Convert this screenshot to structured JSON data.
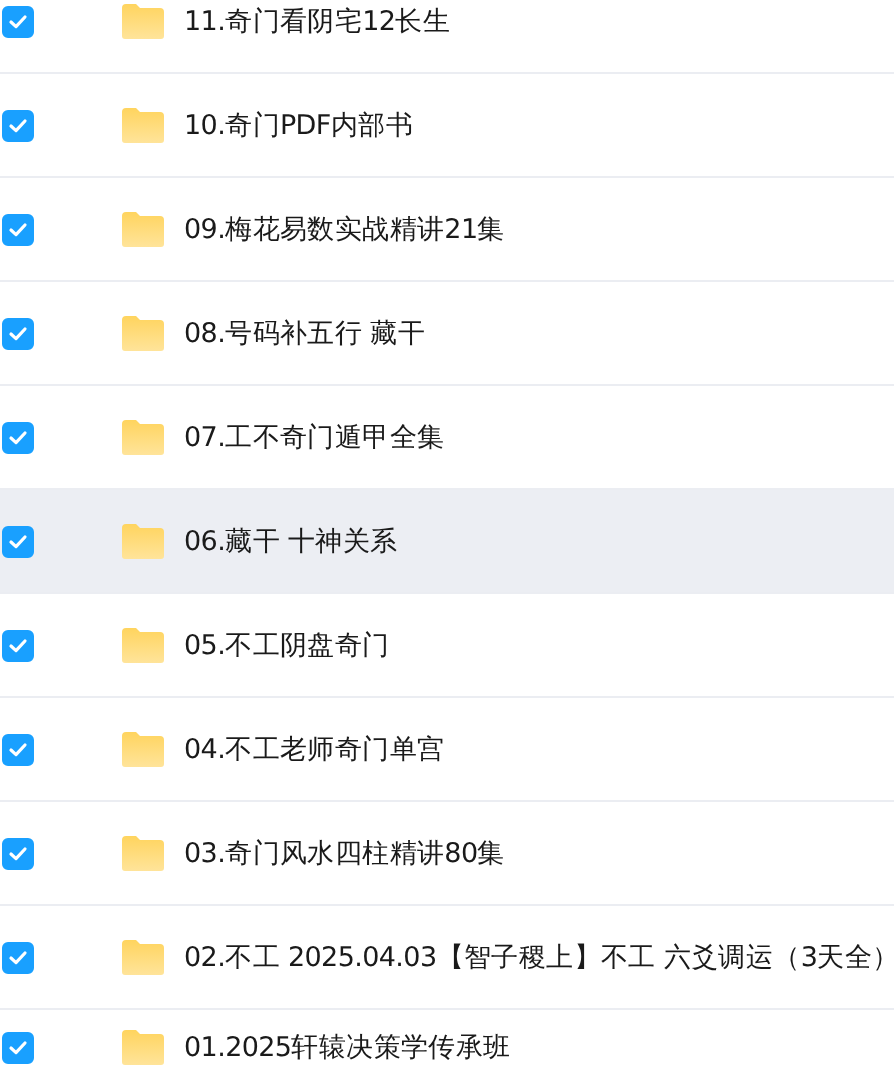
{
  "files": [
    {
      "name": "11.奇门看阴宅12长生",
      "checked": true,
      "hovered": false
    },
    {
      "name": "10.奇门PDF内部书",
      "checked": true,
      "hovered": false
    },
    {
      "name": "09.梅花易数实战精讲21集",
      "checked": true,
      "hovered": false
    },
    {
      "name": "08.号码补五行 藏干",
      "checked": true,
      "hovered": false
    },
    {
      "name": "07.工不奇门遁甲全集",
      "checked": true,
      "hovered": false
    },
    {
      "name": "06.藏干 十神关系",
      "checked": true,
      "hovered": true
    },
    {
      "name": "05.不工阴盘奇门",
      "checked": true,
      "hovered": false
    },
    {
      "name": "04.不工老师奇门单宫",
      "checked": true,
      "hovered": false
    },
    {
      "name": "03.奇门风水四柱精讲80集",
      "checked": true,
      "hovered": false
    },
    {
      "name": "02.不工 2025.04.03【智子稷上】不工 六爻调运（3天全）",
      "checked": true,
      "hovered": false
    },
    {
      "name": "01.2025轩辕决策学传承班",
      "checked": true,
      "hovered": false
    }
  ]
}
